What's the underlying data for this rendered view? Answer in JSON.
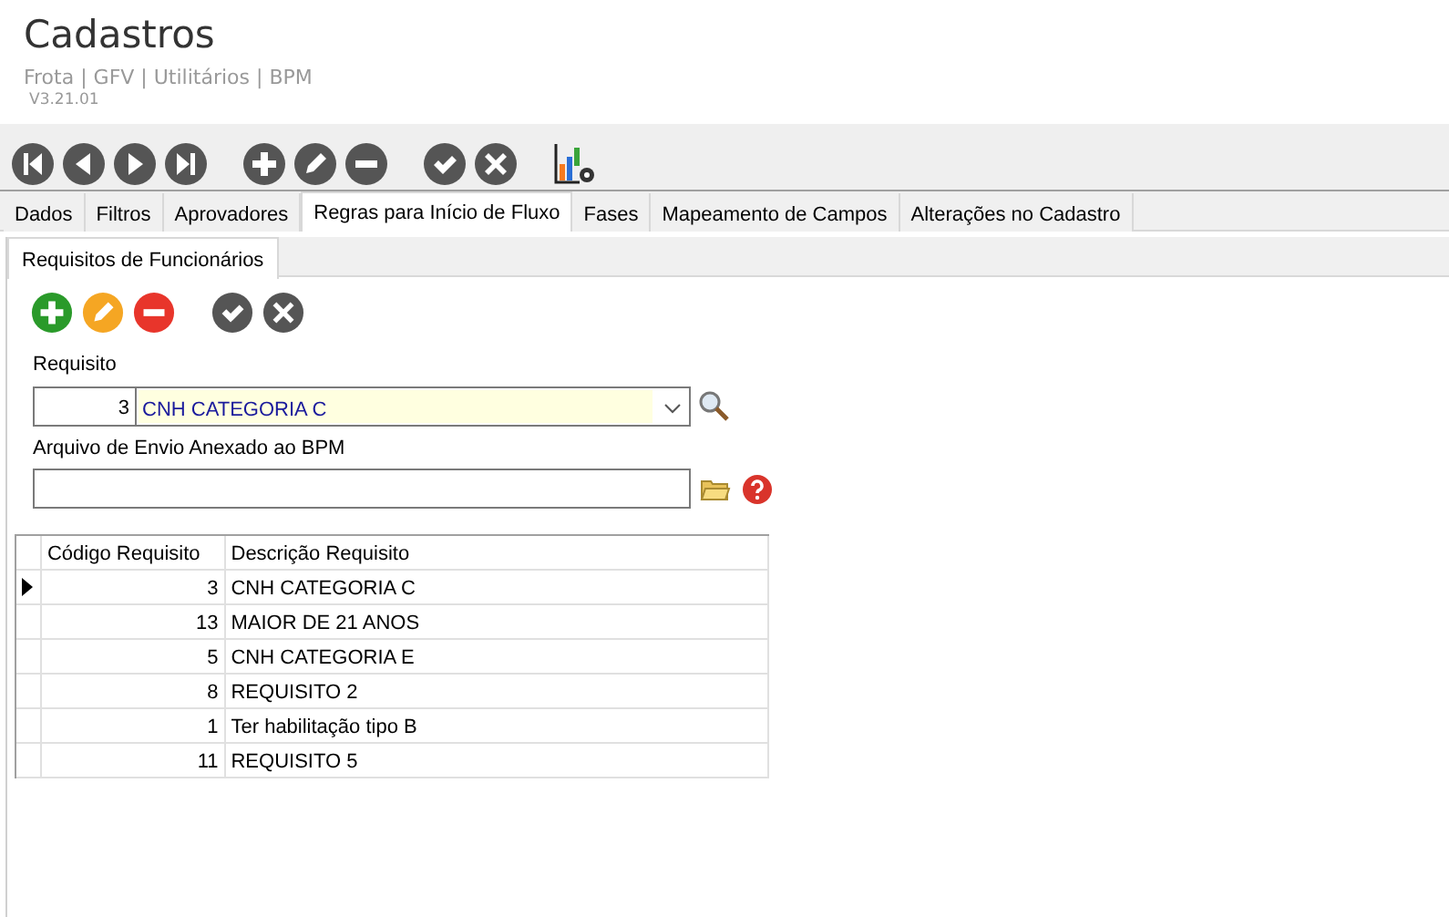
{
  "header": {
    "title": "Cadastros",
    "breadcrumb": "Frota | GFV | Utilitários | BPM",
    "version": "V3.21.01"
  },
  "toolbar": [
    [
      {
        "kind": "first"
      },
      {
        "kind": "prev"
      },
      {
        "kind": "next"
      },
      {
        "kind": "last"
      }
    ],
    [
      {
        "kind": "add"
      },
      {
        "kind": "edit"
      },
      {
        "kind": "remove"
      }
    ],
    [
      {
        "kind": "confirm"
      },
      {
        "kind": "cancel"
      }
    ],
    [
      {
        "kind": "chart"
      }
    ]
  ],
  "tabs": [
    {
      "label": "Dados",
      "selected": false
    },
    {
      "label": "Filtros",
      "selected": false
    },
    {
      "label": "Aprovadores",
      "selected": false
    },
    {
      "label": "Regras para Início de Fluxo",
      "selected": true
    },
    {
      "label": "Fases",
      "selected": false
    },
    {
      "label": "Mapeamento de Campos",
      "selected": false
    },
    {
      "label": "Alterações no Cadastro",
      "selected": false
    }
  ],
  "subtabs": [
    {
      "label": "Requisitos de Funcionários",
      "selected": true
    }
  ],
  "actions": [
    [
      {
        "kind": "add"
      },
      {
        "kind": "edit"
      },
      {
        "kind": "remove"
      }
    ],
    [
      {
        "kind": "confirm"
      },
      {
        "kind": "cancel"
      }
    ]
  ],
  "requisito": {
    "label": "Requisito",
    "code": "3",
    "value": "CNH CATEGORIA C"
  },
  "arquivo": {
    "label": "Arquivo de Envio Anexado ao BPM"
  },
  "grid": {
    "columns": [
      "Código Requisito",
      "Descrição Requisito"
    ],
    "rows": [
      {
        "code": "3",
        "description": "CNH CATEGORIA C",
        "selected": true
      },
      {
        "code": "13",
        "description": "MAIOR DE 21 ANOS",
        "selected": false
      },
      {
        "code": "5",
        "description": "CNH CATEGORIA E",
        "selected": false
      },
      {
        "code": "8",
        "description": "REQUISITO 2",
        "selected": false
      },
      {
        "code": "1",
        "description": "Ter habilitação tipo B",
        "selected": false
      },
      {
        "code": "11",
        "description": "REQUISITO 5",
        "selected": false
      }
    ]
  }
}
